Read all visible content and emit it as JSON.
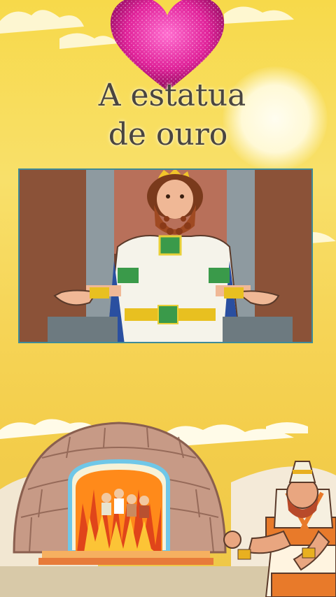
{
  "title_line1": "A estatua",
  "title_line2": "de ouro",
  "icons": {
    "heart": "sparkle-heart-icon",
    "king": "king-on-throne-illustration",
    "furnace": "fiery-furnace-illustration",
    "soldier": "babylonian-king-illustration"
  },
  "colors": {
    "background": "#f7d94a",
    "title_text": "#4a4540",
    "heart": "#e0239a",
    "frame_border": "#3e8a98"
  }
}
